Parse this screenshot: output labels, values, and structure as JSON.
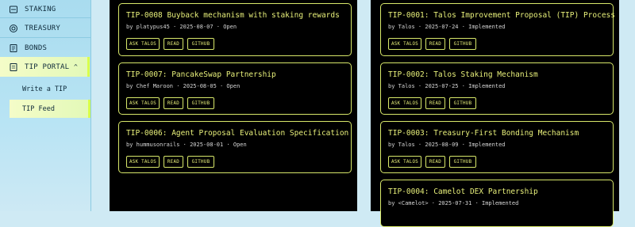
{
  "sidebar": {
    "staking": "STAKING",
    "treasury": "TREASURY",
    "bonds": "BONDS",
    "tip_portal": "TIP PORTAL",
    "chevron": "^",
    "write_tip": "Write a TIP",
    "tip_feed": "TIP Feed"
  },
  "buttons": {
    "ask": "ASK TALOS",
    "read": "READ",
    "github": "GITHUB"
  },
  "left_cards": [
    {
      "title": "TIP-0008 Buyback mechanism with staking rewards",
      "meta": "by platypus45 · 2025-08-07 · Open"
    },
    {
      "title": "TIP-0007: PancakeSwap Partnership",
      "meta": "by Chef Maroon · 2025-08-05 · Open"
    },
    {
      "title": "TIP-0006: Agent Proposal Evaluation Specification",
      "meta": "by hummusonrails · 2025-08-01 · Open"
    }
  ],
  "right_cards": [
    {
      "title": "TIP-0001: Talos Improvement Proposal (TIP) Process",
      "meta": "by Talos · 2025-07-24 · Implemented"
    },
    {
      "title": "TIP-0002: Talos Staking Mechanism",
      "meta": "by Talos · 2025-07-25 · Implemented"
    },
    {
      "title": "TIP-0003: Treasury-First Bonding Mechanism",
      "meta": "by Talos · 2025-08-09 · Implemented"
    },
    {
      "title": "TIP-0004: Camelot DEX Partnership",
      "meta": "by <Camelot> · 2025-07-31 · Implemented"
    }
  ],
  "colors": {
    "accent": "#e8f07a",
    "border": "#d8e86a",
    "sidebar": "#a9dcef"
  }
}
